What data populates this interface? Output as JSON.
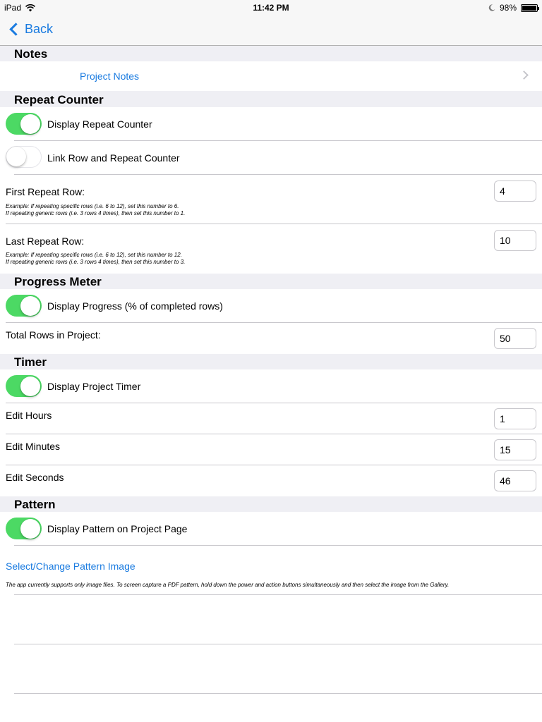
{
  "status_bar": {
    "device": "iPad",
    "time": "11:42 PM",
    "battery": "98%",
    "battery_level": 0.98
  },
  "nav": {
    "back_label": "Back"
  },
  "sections": {
    "notes": {
      "title": "Notes",
      "project_notes_label": "Project Notes"
    },
    "repeat_counter": {
      "title": "Repeat Counter",
      "display_label": "Display Repeat Counter",
      "display_on": true,
      "link_label": "Link Row and Repeat Counter",
      "link_on": false,
      "first_row_label": "First Repeat Row:",
      "first_row_value": "4",
      "first_hint_1": "Example: If repeating specific rows (i.e. 6 to 12), set this number to 6.",
      "first_hint_2": "If repeating generic rows (i.e. 3 rows 4 times), then set this number to 1.",
      "last_row_label": "Last Repeat Row:",
      "last_row_value": "10",
      "last_hint_1": "Example: If repeating specific rows (i.e. 6 to 12), set this number to 12.",
      "last_hint_2": "If repeating generic rows (i.e. 3 rows 4 times), then set this number to 3."
    },
    "progress": {
      "title": "Progress Meter",
      "display_label": "Display Progress (% of completed rows)",
      "display_on": true,
      "total_rows_label": "Total Rows in Project:",
      "total_rows_value": "50"
    },
    "timer": {
      "title": "Timer",
      "display_label": "Display Project Timer",
      "display_on": true,
      "hours_label": "Edit Hours",
      "hours_value": "1",
      "minutes_label": "Edit Minutes",
      "minutes_value": "15",
      "seconds_label": "Edit Seconds",
      "seconds_value": "46"
    },
    "pattern": {
      "title": "Pattern",
      "display_label": "Display Pattern on Project Page",
      "display_on": true,
      "select_label": "Select/Change Pattern Image",
      "hint": "The app currently supports only image files.  To screen capture a PDF pattern, hold down the power and action buttons simultaneously and then select the image from the Gallery."
    }
  },
  "colors": {
    "accent": "#1a7be0",
    "toggle_on": "#4cd964",
    "group_bg": "#efeff4"
  }
}
